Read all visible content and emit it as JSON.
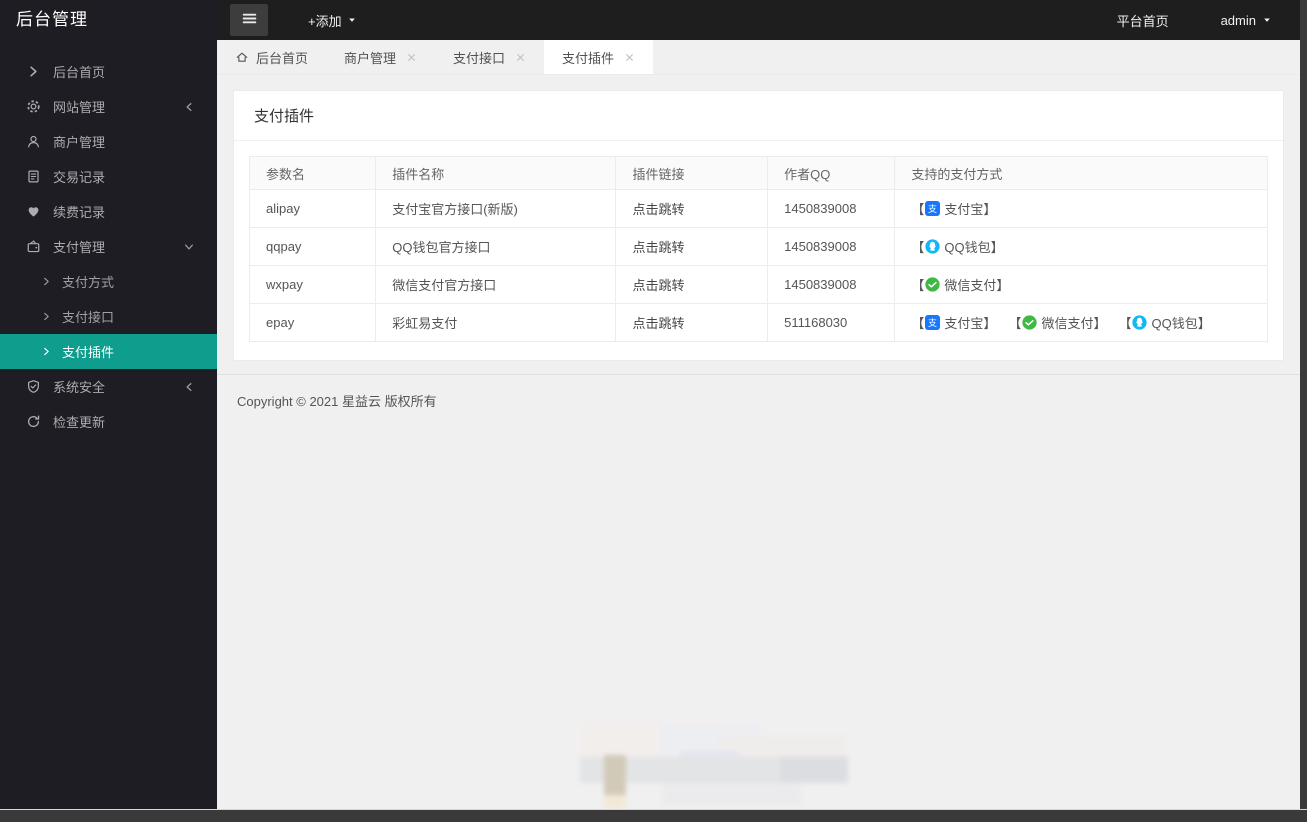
{
  "sidebar": {
    "title": "后台管理",
    "items": [
      {
        "key": "dashboard-home",
        "label": "后台首页",
        "icon": "chevron-right",
        "sub": false,
        "active": false,
        "arrow": null
      },
      {
        "key": "site-management",
        "label": "网站管理",
        "icon": "gear",
        "sub": false,
        "active": false,
        "arrow": "chevron-left"
      },
      {
        "key": "merchant-management",
        "label": "商户管理",
        "icon": "user",
        "sub": false,
        "active": false,
        "arrow": null
      },
      {
        "key": "transaction-records",
        "label": "交易记录",
        "icon": "document",
        "sub": false,
        "active": false,
        "arrow": null
      },
      {
        "key": "renewal-records",
        "label": "续费记录",
        "icon": "hearts",
        "sub": false,
        "active": false,
        "arrow": null
      },
      {
        "key": "payment-management",
        "label": "支付管理",
        "icon": "wallet",
        "sub": false,
        "active": false,
        "arrow": "chevron-down"
      },
      {
        "key": "payment-methods",
        "label": "支付方式",
        "icon": "chevron-right",
        "sub": true,
        "active": false,
        "arrow": null
      },
      {
        "key": "payment-interface",
        "label": "支付接口",
        "icon": "chevron-right",
        "sub": true,
        "active": false,
        "arrow": null
      },
      {
        "key": "payment-plugins",
        "label": "支付插件",
        "icon": "chevron-right",
        "sub": true,
        "active": true,
        "arrow": null
      },
      {
        "key": "system-security",
        "label": "系统安全",
        "icon": "shield",
        "sub": false,
        "active": false,
        "arrow": "chevron-left"
      },
      {
        "key": "check-updates",
        "label": "检查更新",
        "icon": "refresh",
        "sub": false,
        "active": false,
        "arrow": null
      }
    ]
  },
  "topbar": {
    "add_label": "+添加",
    "platform_home": "平台首页",
    "user": "admin"
  },
  "tabs": [
    {
      "key": "dashboard-home",
      "label": "后台首页",
      "icon": "home",
      "closable": false,
      "active": false
    },
    {
      "key": "merchant-management",
      "label": "商户管理",
      "icon": null,
      "closable": true,
      "active": false
    },
    {
      "key": "payment-interface",
      "label": "支付接口",
      "icon": null,
      "closable": true,
      "active": false
    },
    {
      "key": "payment-plugins",
      "label": "支付插件",
      "icon": null,
      "closable": true,
      "active": true
    }
  ],
  "panel": {
    "title": "支付插件",
    "table": {
      "headers": [
        "参数名",
        "插件名称",
        "插件链接",
        "作者QQ",
        "支持的支付方式"
      ],
      "rows": [
        {
          "param": "alipay",
          "name": "支付宝官方接口(新版)",
          "link": "点击跳转",
          "qq": "1450839008",
          "methods": [
            {
              "icon": "alipay",
              "label": "支付宝"
            }
          ]
        },
        {
          "param": "qqpay",
          "name": "QQ钱包官方接口",
          "link": "点击跳转",
          "qq": "1450839008",
          "methods": [
            {
              "icon": "qq",
              "label": "QQ钱包"
            }
          ]
        },
        {
          "param": "wxpay",
          "name": "微信支付官方接口",
          "link": "点击跳转",
          "qq": "1450839008",
          "methods": [
            {
              "icon": "wechat",
              "label": "微信支付"
            }
          ]
        },
        {
          "param": "epay",
          "name": "彩虹易支付",
          "link": "点击跳转",
          "qq": "511168030",
          "methods": [
            {
              "icon": "alipay",
              "label": "支付宝"
            },
            {
              "icon": "wechat",
              "label": "微信支付"
            },
            {
              "icon": "qq",
              "label": "QQ钱包"
            }
          ]
        }
      ],
      "bracket_open": "【",
      "bracket_close": "】"
    }
  },
  "footer": {
    "copyright": "Copyright © 2021 星益云 版权所有"
  },
  "colors": {
    "accent": "#0f9d8e",
    "sidebar_bg": "#1d1d23",
    "topbar_bg": "#1e1e1e",
    "alipay": "#1678ff",
    "wechat": "#3db944",
    "qq": "#12b7f5"
  }
}
